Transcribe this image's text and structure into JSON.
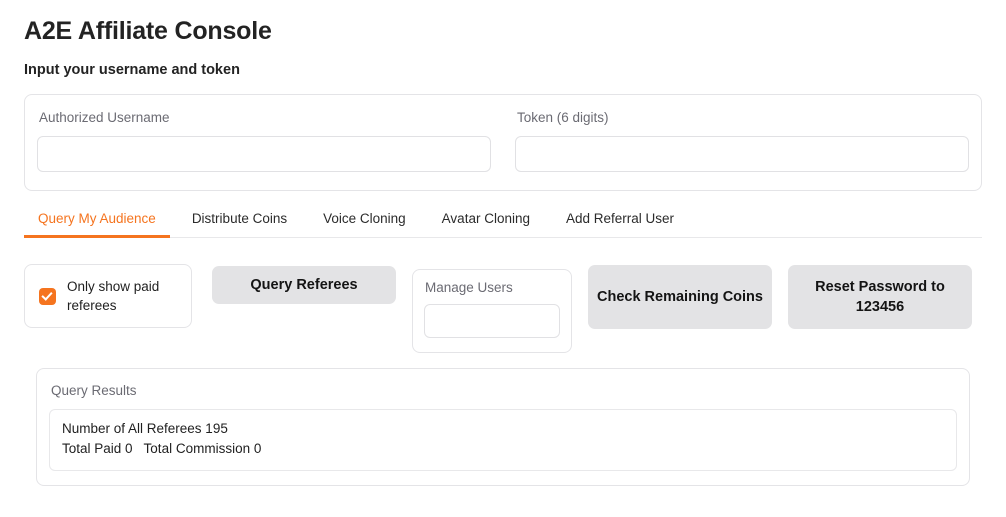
{
  "header": {
    "title": "A2E Affiliate Console",
    "subtitle": "Input your username and token"
  },
  "credentials": {
    "username": {
      "label": "Authorized Username",
      "value": "",
      "placeholder": ""
    },
    "token": {
      "label": "Token (6 digits)",
      "value": "",
      "placeholder": ""
    }
  },
  "tabs": [
    {
      "label": "Query My Audience",
      "active": true
    },
    {
      "label": "Distribute Coins",
      "active": false
    },
    {
      "label": "Voice Cloning",
      "active": false
    },
    {
      "label": "Avatar Cloning",
      "active": false
    },
    {
      "label": "Add Referral User",
      "active": false
    }
  ],
  "controls": {
    "paid_only": {
      "label": "Only show paid referees",
      "checked": true
    },
    "query_referees_label": "Query Referees",
    "manage_users": {
      "label": "Manage Users",
      "value": "",
      "placeholder": ""
    },
    "check_coins_label": "Check Remaining Coins",
    "reset_password_label": "Reset Password to 123456"
  },
  "results": {
    "label": "Query Results",
    "lines": [
      "Number of All Referees 195",
      "Total Paid 0   Total Commission 0"
    ]
  },
  "colors": {
    "accent": "#f5741f",
    "button_bg": "#e3e3e5",
    "border": "#e4e4e7",
    "muted_text": "#6b6b73"
  }
}
